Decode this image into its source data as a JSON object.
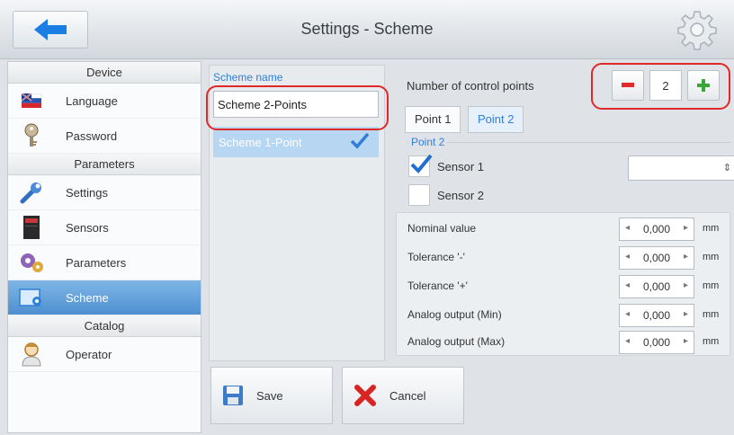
{
  "window": {
    "title": "Settings - Scheme"
  },
  "icons": {
    "back": "arrow-left-icon",
    "settings": "gear-icon"
  },
  "colors": {
    "accent": "#2f7fd6",
    "active": "#4f8fd0",
    "highlight": "#e02828"
  },
  "sidebar": {
    "sections": [
      {
        "header": "Device",
        "items": [
          {
            "label": "Language",
            "icon": "flag-icon"
          },
          {
            "label": "Password",
            "icon": "key-icon"
          }
        ]
      },
      {
        "header": "Parameters",
        "items": [
          {
            "label": "Settings",
            "icon": "wrench-icon"
          },
          {
            "label": "Sensors",
            "icon": "sensor-icon"
          },
          {
            "label": "Parameters",
            "icon": "gears-icon"
          },
          {
            "label": "Scheme",
            "icon": "scheme-icon",
            "active": true
          }
        ]
      },
      {
        "header": "Catalog",
        "items": [
          {
            "label": "Operator",
            "icon": "user-icon"
          }
        ]
      }
    ]
  },
  "scheme": {
    "name_label": "Scheme name",
    "name_value": "Scheme 2-Points",
    "list": [
      {
        "label": "Scheme 1-Point",
        "selected": true
      }
    ]
  },
  "control_points": {
    "label": "Number of control points",
    "value": "2",
    "tabs": [
      {
        "label": "Point 1"
      },
      {
        "label": "Point 2",
        "active": true
      }
    ],
    "group_title": "Point 2",
    "sensors": [
      {
        "label": "Sensor 1",
        "checked": true
      },
      {
        "label": "Sensor 2",
        "checked": false
      }
    ],
    "sensor_select_value": ""
  },
  "values": [
    {
      "label": "Nominal value",
      "value": "0,000",
      "unit": "mm"
    },
    {
      "label": "Tolerance '-'",
      "value": "0,000",
      "unit": "mm"
    },
    {
      "label": "Tolerance '+'",
      "value": "0,000",
      "unit": "mm"
    },
    {
      "label": "Analog output (Min)",
      "value": "0,000",
      "unit": "mm"
    },
    {
      "label": "Analog output (Max)",
      "value": "0,000",
      "unit": "mm"
    }
  ],
  "actions": {
    "save": "Save",
    "cancel": "Cancel"
  }
}
